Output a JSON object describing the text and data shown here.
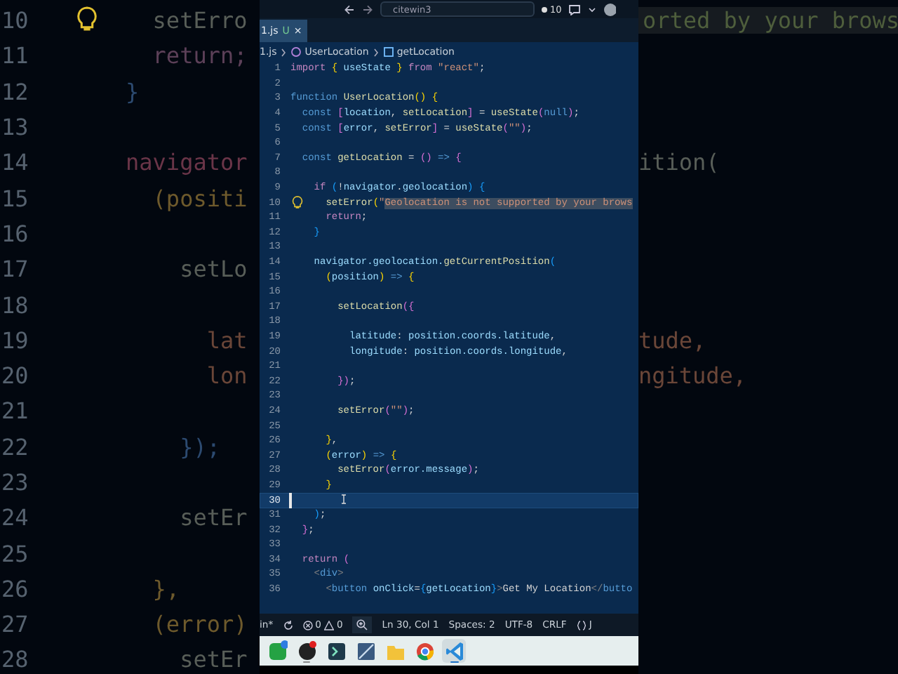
{
  "backdrop": [
    {
      "number": "10",
      "left": {
        "text": "      setErro",
        "kind": "function"
      },
      "lightbulb": true,
      "right": {
        "text": "orted by your brows",
        "kind": "highlight"
      }
    },
    {
      "number": "11",
      "left": {
        "text": "      return;",
        "kind": "keyword"
      },
      "lightbulb": false
    },
    {
      "number": "12",
      "left": {
        "text": "    }",
        "kind": "bracket"
      },
      "lightbulb": false
    },
    {
      "number": "13",
      "lightbulb": false
    },
    {
      "number": "14",
      "left": {
        "text": "    navigator",
        "kind": "variable"
      },
      "lightbulb": false,
      "right": {
        "text": "ition(",
        "kind": "function"
      }
    },
    {
      "number": "15",
      "left": {
        "text": "      (positi",
        "kind": "parameter"
      },
      "lightbulb": false
    },
    {
      "number": "16",
      "lightbulb": false
    },
    {
      "number": "17",
      "left": {
        "text": "        setLo",
        "kind": "function"
      },
      "lightbulb": false
    },
    {
      "number": "18",
      "lightbulb": false
    },
    {
      "number": "19",
      "left": {
        "text": "          lat",
        "kind": "property"
      },
      "lightbulb": false,
      "right": {
        "text": "tude,",
        "kind": "property"
      }
    },
    {
      "number": "20",
      "left": {
        "text": "          lon",
        "kind": "property"
      },
      "lightbulb": false,
      "right": {
        "text": "ngitude,",
        "kind": "property"
      }
    },
    {
      "number": "21",
      "lightbulb": false
    },
    {
      "number": "22",
      "left": {
        "text": "        });",
        "kind": "bracket"
      },
      "lightbulb": false
    },
    {
      "number": "23",
      "lightbulb": false
    },
    {
      "number": "24",
      "left": {
        "text": "        setEr",
        "kind": "function"
      },
      "lightbulb": false
    },
    {
      "number": "25",
      "lightbulb": false
    },
    {
      "number": "26",
      "left": {
        "text": "      },",
        "kind": "parameter"
      },
      "lightbulb": false
    },
    {
      "number": "27",
      "left": {
        "text": "      (error)",
        "kind": "parameter"
      },
      "lightbulb": false
    },
    {
      "number": "28",
      "left": {
        "text": "        setEr",
        "kind": "function"
      },
      "lightbulb": false
    }
  ],
  "editor": {
    "toolbar": {
      "search": "citewin3",
      "badge": "10"
    },
    "tab": {
      "label": "1.js",
      "status": "U",
      "close": "×",
      "selected": true
    },
    "breadcrumb": [
      {
        "label": "1.js",
        "kind": "file"
      },
      {
        "label": "UserLocation",
        "kind": "component"
      },
      {
        "label": "getLocation",
        "kind": "method"
      }
    ],
    "lines": [
      {
        "number": "1",
        "current": false,
        "lightbulb": false,
        "tokens": [
          {
            "text": "import ",
            "kind": "keyword"
          },
          {
            "text": "{",
            "kind": "bracket1"
          },
          {
            "text": " useState ",
            "kind": "variable"
          },
          {
            "text": "}",
            "kind": "bracket1"
          },
          {
            "text": " from ",
            "kind": "keyword"
          },
          {
            "text": "\"react\"",
            "kind": "string"
          },
          {
            "text": ";",
            "kind": "plain"
          }
        ]
      },
      {
        "number": "2",
        "current": false,
        "lightbulb": false
      },
      {
        "number": "3",
        "current": false,
        "lightbulb": false,
        "tokens": [
          {
            "text": "function ",
            "kind": "storage"
          },
          {
            "text": "UserLocation",
            "kind": "function"
          },
          {
            "text": "() {",
            "kind": "bracket1"
          }
        ]
      },
      {
        "number": "4",
        "current": false,
        "lightbulb": false,
        "tokens": [
          {
            "text": "  const ",
            "kind": "storage"
          },
          {
            "text": "[",
            "kind": "bracket2"
          },
          {
            "text": "location",
            "kind": "variable"
          },
          {
            "text": ", ",
            "kind": "plain"
          },
          {
            "text": "setLocation",
            "kind": "function"
          },
          {
            "text": "]",
            "kind": "bracket2"
          },
          {
            "text": " = ",
            "kind": "plain"
          },
          {
            "text": "useState",
            "kind": "function"
          },
          {
            "text": "(",
            "kind": "bracket2"
          },
          {
            "text": "null",
            "kind": "storage"
          },
          {
            "text": ")",
            "kind": "bracket2"
          },
          {
            "text": ";",
            "kind": "plain"
          }
        ]
      },
      {
        "number": "5",
        "current": false,
        "lightbulb": false,
        "tokens": [
          {
            "text": "  const ",
            "kind": "storage"
          },
          {
            "text": "[",
            "kind": "bracket2"
          },
          {
            "text": "error",
            "kind": "variable"
          },
          {
            "text": ", ",
            "kind": "plain"
          },
          {
            "text": "setError",
            "kind": "function"
          },
          {
            "text": "]",
            "kind": "bracket2"
          },
          {
            "text": " = ",
            "kind": "plain"
          },
          {
            "text": "useState",
            "kind": "function"
          },
          {
            "text": "(",
            "kind": "bracket2"
          },
          {
            "text": "\"\"",
            "kind": "string"
          },
          {
            "text": ")",
            "kind": "bracket2"
          },
          {
            "text": ";",
            "kind": "plain"
          }
        ]
      },
      {
        "number": "6",
        "current": false,
        "lightbulb": false
      },
      {
        "number": "7",
        "current": false,
        "lightbulb": false,
        "tokens": [
          {
            "text": "  const ",
            "kind": "storage"
          },
          {
            "text": "getLocation",
            "kind": "function"
          },
          {
            "text": " = ",
            "kind": "plain"
          },
          {
            "text": "()",
            "kind": "bracket2"
          },
          {
            "text": " => ",
            "kind": "storage"
          },
          {
            "text": "{",
            "kind": "bracket2"
          }
        ]
      },
      {
        "number": "8",
        "current": false,
        "lightbulb": false
      },
      {
        "number": "9",
        "current": false,
        "lightbulb": false,
        "tokens": [
          {
            "text": "    if ",
            "kind": "keyword"
          },
          {
            "text": "(",
            "kind": "bracket3"
          },
          {
            "text": "!",
            "kind": "plain"
          },
          {
            "text": "navigator",
            "kind": "variable"
          },
          {
            "text": ".",
            "kind": "plain"
          },
          {
            "text": "geolocation",
            "kind": "variable"
          },
          {
            "text": ")",
            "kind": "bracket3"
          },
          {
            "text": " {",
            "kind": "bracket3"
          }
        ]
      },
      {
        "number": "10",
        "current": false,
        "lightbulb": true,
        "tokens": [
          {
            "text": "      setError",
            "kind": "function"
          },
          {
            "text": "(",
            "kind": "bracket1"
          },
          {
            "text": "\"",
            "kind": "string"
          },
          {
            "text": "Geolocation is not supported by your brows",
            "kind": "highlight"
          }
        ]
      },
      {
        "number": "11",
        "current": false,
        "lightbulb": false,
        "tokens": [
          {
            "text": "      return",
            "kind": "keyword"
          },
          {
            "text": ";",
            "kind": "plain"
          }
        ]
      },
      {
        "number": "12",
        "current": false,
        "lightbulb": false,
        "tokens": [
          {
            "text": "    }",
            "kind": "bracket3"
          }
        ]
      },
      {
        "number": "13",
        "current": false,
        "lightbulb": false
      },
      {
        "number": "14",
        "current": false,
        "lightbulb": false,
        "tokens": [
          {
            "text": "    navigator.geolocation.",
            "kind": "variable"
          },
          {
            "text": "getCurrentPosition",
            "kind": "function"
          },
          {
            "text": "(",
            "kind": "bracket3"
          }
        ]
      },
      {
        "number": "15",
        "current": false,
        "lightbulb": false,
        "tokens": [
          {
            "text": "      (",
            "kind": "bracket1"
          },
          {
            "text": "position",
            "kind": "variable"
          },
          {
            "text": ")",
            "kind": "bracket1"
          },
          {
            "text": " => ",
            "kind": "storage"
          },
          {
            "text": "{",
            "kind": "bracket1"
          }
        ]
      },
      {
        "number": "16",
        "current": false,
        "lightbulb": false
      },
      {
        "number": "17",
        "current": false,
        "lightbulb": false,
        "tokens": [
          {
            "text": "        setLocation",
            "kind": "function"
          },
          {
            "text": "({",
            "kind": "bracket2"
          }
        ]
      },
      {
        "number": "18",
        "current": false,
        "lightbulb": false
      },
      {
        "number": "19",
        "current": false,
        "lightbulb": false,
        "tokens": [
          {
            "text": "          latitude",
            "kind": "variable"
          },
          {
            "text": ": ",
            "kind": "plain"
          },
          {
            "text": "position.coords.latitude",
            "kind": "variable"
          },
          {
            "text": ",",
            "kind": "plain"
          }
        ]
      },
      {
        "number": "20",
        "current": false,
        "lightbulb": false,
        "tokens": [
          {
            "text": "          longitude",
            "kind": "variable"
          },
          {
            "text": ": ",
            "kind": "plain"
          },
          {
            "text": "position.coords.longitude",
            "kind": "variable"
          },
          {
            "text": ",",
            "kind": "plain"
          }
        ]
      },
      {
        "number": "21",
        "current": false,
        "lightbulb": false
      },
      {
        "number": "22",
        "current": false,
        "lightbulb": false,
        "tokens": [
          {
            "text": "        })",
            "kind": "bracket2"
          },
          {
            "text": ";",
            "kind": "plain"
          }
        ]
      },
      {
        "number": "23",
        "current": false,
        "lightbulb": false
      },
      {
        "number": "24",
        "current": false,
        "lightbulb": false,
        "tokens": [
          {
            "text": "        setError",
            "kind": "function"
          },
          {
            "text": "(",
            "kind": "bracket2"
          },
          {
            "text": "\"\"",
            "kind": "string"
          },
          {
            "text": ")",
            "kind": "bracket2"
          },
          {
            "text": ";",
            "kind": "plain"
          }
        ]
      },
      {
        "number": "25",
        "current": false,
        "lightbulb": false
      },
      {
        "number": "26",
        "current": false,
        "lightbulb": false,
        "tokens": [
          {
            "text": "      }",
            "kind": "bracket1"
          },
          {
            "text": ",",
            "kind": "plain"
          }
        ]
      },
      {
        "number": "27",
        "current": false,
        "lightbulb": false,
        "tokens": [
          {
            "text": "      (",
            "kind": "bracket1"
          },
          {
            "text": "error",
            "kind": "variable"
          },
          {
            "text": ")",
            "kind": "bracket1"
          },
          {
            "text": " => ",
            "kind": "storage"
          },
          {
            "text": "{",
            "kind": "bracket1"
          }
        ]
      },
      {
        "number": "28",
        "current": false,
        "lightbulb": false,
        "tokens": [
          {
            "text": "        setError",
            "kind": "function"
          },
          {
            "text": "(",
            "kind": "bracket2"
          },
          {
            "text": "error.message",
            "kind": "variable"
          },
          {
            "text": ")",
            "kind": "bracket2"
          },
          {
            "text": ";",
            "kind": "plain"
          }
        ]
      },
      {
        "number": "29",
        "current": false,
        "lightbulb": false,
        "tokens": [
          {
            "text": "      }",
            "kind": "bracket1"
          }
        ]
      },
      {
        "number": "30",
        "current": true,
        "lightbulb": false
      },
      {
        "number": "31",
        "current": false,
        "lightbulb": false,
        "tokens": [
          {
            "text": "    )",
            "kind": "bracket3"
          },
          {
            "text": ";",
            "kind": "plain"
          }
        ]
      },
      {
        "number": "32",
        "current": false,
        "lightbulb": false,
        "tokens": [
          {
            "text": "  }",
            "kind": "bracket2"
          },
          {
            "text": ";",
            "kind": "plain"
          }
        ]
      },
      {
        "number": "33",
        "current": false,
        "lightbulb": false
      },
      {
        "number": "34",
        "current": false,
        "lightbulb": false,
        "tokens": [
          {
            "text": "  return ",
            "kind": "keyword"
          },
          {
            "text": "(",
            "kind": "bracket2"
          }
        ]
      },
      {
        "number": "35",
        "current": false,
        "lightbulb": false,
        "tokens": [
          {
            "text": "    <",
            "kind": "tagpunct"
          },
          {
            "text": "div",
            "kind": "tag"
          },
          {
            "text": ">",
            "kind": "tagpunct"
          }
        ]
      },
      {
        "number": "36",
        "current": false,
        "lightbulb": false,
        "tokens": [
          {
            "text": "      <",
            "kind": "tagpunct"
          },
          {
            "text": "button",
            "kind": "tag"
          },
          {
            "text": " onClick",
            "kind": "variable"
          },
          {
            "text": "=",
            "kind": "plain"
          },
          {
            "text": "{",
            "kind": "bracket3"
          },
          {
            "text": "getLocation",
            "kind": "variable"
          },
          {
            "text": "}",
            "kind": "bracket3"
          },
          {
            "text": ">",
            "kind": "tagpunct"
          },
          {
            "text": "Get My Location",
            "kind": "plain"
          },
          {
            "text": "</",
            "kind": "tagpunct"
          },
          {
            "text": "butto",
            "kind": "tag"
          }
        ]
      }
    ],
    "status_bar": {
      "branch": "in*",
      "errors": "0",
      "warnings": "0",
      "position": "Ln 30, Col 1",
      "spaces": "Spaces: 2",
      "encoding": "UTF-8",
      "eol": "CRLF",
      "language": "J"
    },
    "taskbar": [
      {
        "kind": "chat",
        "selected": false,
        "running": false
      },
      {
        "kind": "recorder",
        "selected": false,
        "running": true
      },
      {
        "kind": "terminal",
        "selected": false,
        "running": false
      },
      {
        "kind": "drawing",
        "selected": false,
        "running": false
      },
      {
        "kind": "folder",
        "selected": false,
        "running": false
      },
      {
        "kind": "browser",
        "selected": false,
        "running": false
      },
      {
        "kind": "code",
        "selected": true,
        "running": true
      }
    ]
  }
}
